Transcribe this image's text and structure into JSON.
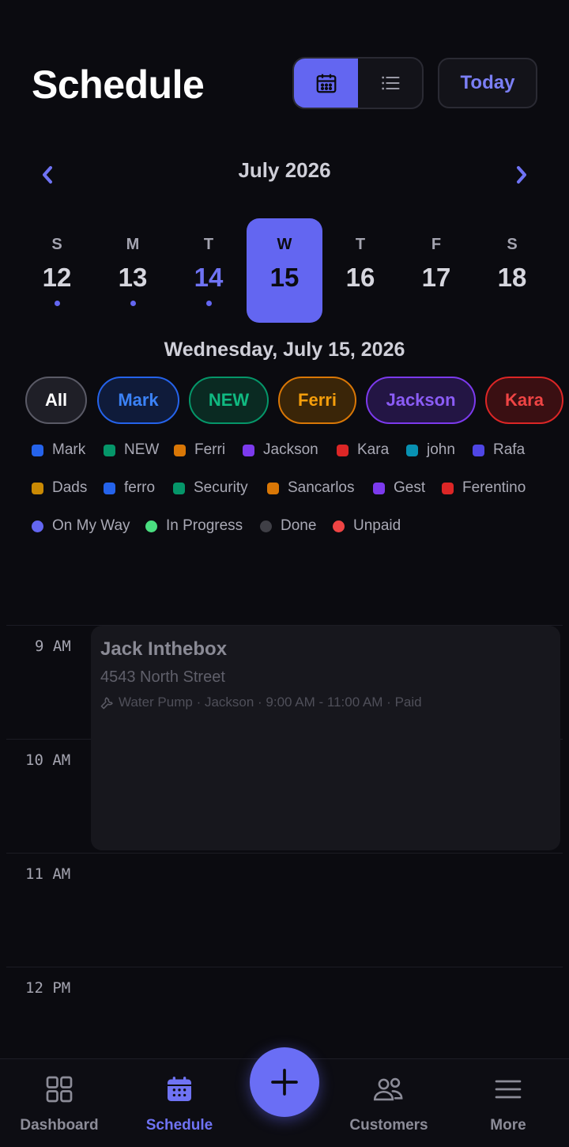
{
  "header": {
    "title": "Schedule",
    "today_label": "Today"
  },
  "calendar": {
    "month": "July 2026",
    "days": [
      {
        "dow": "S",
        "num": "12"
      },
      {
        "dow": "M",
        "num": "13"
      },
      {
        "dow": "T",
        "num": "14"
      },
      {
        "dow": "W",
        "num": "15"
      },
      {
        "dow": "T",
        "num": "16"
      },
      {
        "dow": "F",
        "num": "17"
      },
      {
        "dow": "S",
        "num": "18"
      }
    ],
    "selected_date": "Wednesday, July 15, 2026"
  },
  "filters": [
    "All",
    "Mark",
    "NEW",
    "Ferri",
    "Jackson",
    "Kara"
  ],
  "filter_colors": {
    "all": "#3a3a44",
    "mark": "#2563eb",
    "new": "#059669",
    "ferri": "#d97706",
    "jackson": "#7c3aed",
    "kara": "#dc2626"
  },
  "legend": [
    [
      {
        "label": "Mark",
        "color": "#2563eb"
      },
      {
        "label": "NEW",
        "color": "#059669"
      },
      {
        "label": "Ferri",
        "color": "#d97706"
      },
      {
        "label": "Jackson",
        "color": "#7c3aed"
      },
      {
        "label": "Kara",
        "color": "#dc2626"
      },
      {
        "label": "john",
        "color": "#0891b2"
      },
      {
        "label": "Rafa",
        "color": "#4f46e5"
      }
    ],
    [
      {
        "label": "Dads",
        "color": "#ca8a04"
      },
      {
        "label": "ferro",
        "color": "#2563eb"
      },
      {
        "label": "Security",
        "color": "#059669"
      },
      {
        "label": "Sancarlos",
        "color": "#d97706"
      },
      {
        "label": "Gest",
        "color": "#7c3aed"
      },
      {
        "label": "Ferentino",
        "color": "#dc2626"
      }
    ],
    [
      {
        "label": "On My Way",
        "color": "#6366f1"
      },
      {
        "label": "In Progress",
        "color": "#4ade80"
      },
      {
        "label": "Done",
        "color": "#3f3f46"
      },
      {
        "label": "Unpaid",
        "color": "#ef4444"
      }
    ]
  ],
  "hours": [
    "9 AM",
    "10 AM",
    "11 AM",
    "12 PM"
  ],
  "event": {
    "title": "Jack Inthebox",
    "address": "4543 North Street",
    "meta": "Water Pump · Jackson · 9:00 AM - 11:00 AM · Paid"
  },
  "nav": {
    "dashboard": "Dashboard",
    "schedule": "Schedule",
    "customers": "Customers",
    "more": "More"
  },
  "colors": {
    "accent": "#6366f1",
    "background": "#0b0b10"
  }
}
